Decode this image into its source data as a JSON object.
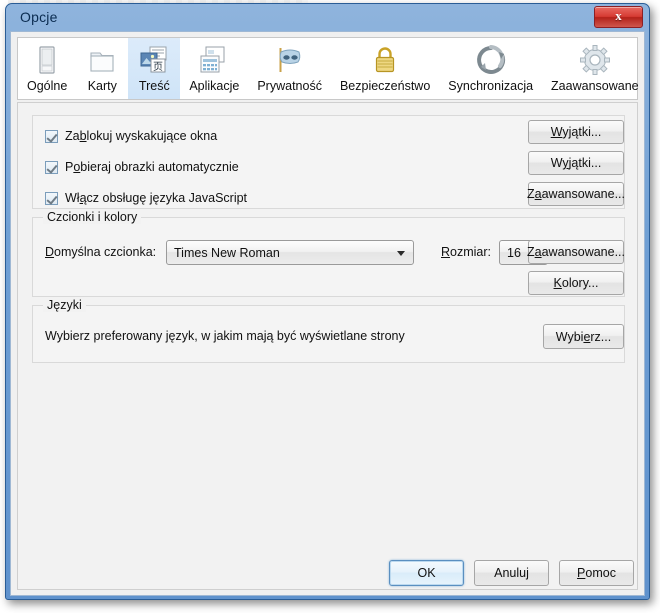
{
  "window": {
    "title": "Opcje",
    "close_label": "x",
    "close_icon": "close-icon"
  },
  "tabs": [
    {
      "label": "Ogólne",
      "icon": "general-panel-icon",
      "selected": false
    },
    {
      "label": "Karty",
      "icon": "tabs-folder-icon",
      "selected": false
    },
    {
      "label": "Treść",
      "icon": "content-page-icon",
      "selected": true
    },
    {
      "label": "Aplikacje",
      "icon": "applications-icon",
      "selected": false
    },
    {
      "label": "Prywatność",
      "icon": "privacy-mask-icon",
      "selected": false
    },
    {
      "label": "Bezpieczeństwo",
      "icon": "security-lock-icon",
      "selected": false
    },
    {
      "label": "Synchronizacja",
      "icon": "sync-arrows-icon",
      "selected": false
    },
    {
      "label": "Zaawansowane",
      "icon": "advanced-gear-icon",
      "selected": false
    }
  ],
  "content": {
    "checkboxes": [
      {
        "label_pre": "Za",
        "label_acc": "b",
        "label_post": "lokuj wyskakujące okna",
        "checked": true
      },
      {
        "label_pre": "P",
        "label_acc": "o",
        "label_post": "bieraj obrazki automatycznie",
        "checked": true
      },
      {
        "label_pre": "Wł",
        "label_acc": "ą",
        "label_post": "cz obsługę języka JavaScript",
        "checked": true
      }
    ],
    "checkbox_buttons": [
      {
        "pre": "",
        "acc": "W",
        "post": "yjątki..."
      },
      {
        "pre": "W",
        "acc": "y",
        "post": "jątki..."
      },
      {
        "pre": "Z",
        "acc": "a",
        "post": "awansowane..."
      }
    ],
    "fonts_group": {
      "title": "Czcionki i kolory",
      "font_label_pre": "",
      "font_label_acc": "D",
      "font_label_post": "omyślna czcionka:",
      "font_value": "Times New Roman",
      "size_label_pre": "",
      "size_label_acc": "R",
      "size_label_post": "ozmiar:",
      "size_value": "16",
      "advanced_button": {
        "pre": "Z",
        "acc": "a",
        "post": "awansowane..."
      },
      "colors_button": {
        "pre": "",
        "acc": "K",
        "post": "olory..."
      }
    },
    "languages_group": {
      "title": "Języki",
      "description": "Wybierz preferowany język, w jakim mają być wyświetlane strony",
      "choose_button": {
        "pre": "Wybi",
        "acc": "e",
        "post": "rz..."
      }
    }
  },
  "dialog_buttons": [
    {
      "pre": "OK",
      "acc": "",
      "post": "",
      "name": "ok-button",
      "focused": true
    },
    {
      "pre": "Anuluj",
      "acc": "",
      "post": "",
      "name": "cancel-button",
      "focused": false
    },
    {
      "pre": "",
      "acc": "P",
      "post": "omoc",
      "name": "help-button",
      "focused": false
    }
  ],
  "colors": {
    "frame_blue": "#6f9fd4",
    "close_red": "#d63b33",
    "selected_tab": "#d4e6f8",
    "panel_bg": "#f2f2f2",
    "focus_blue": "#5a8fc0"
  }
}
